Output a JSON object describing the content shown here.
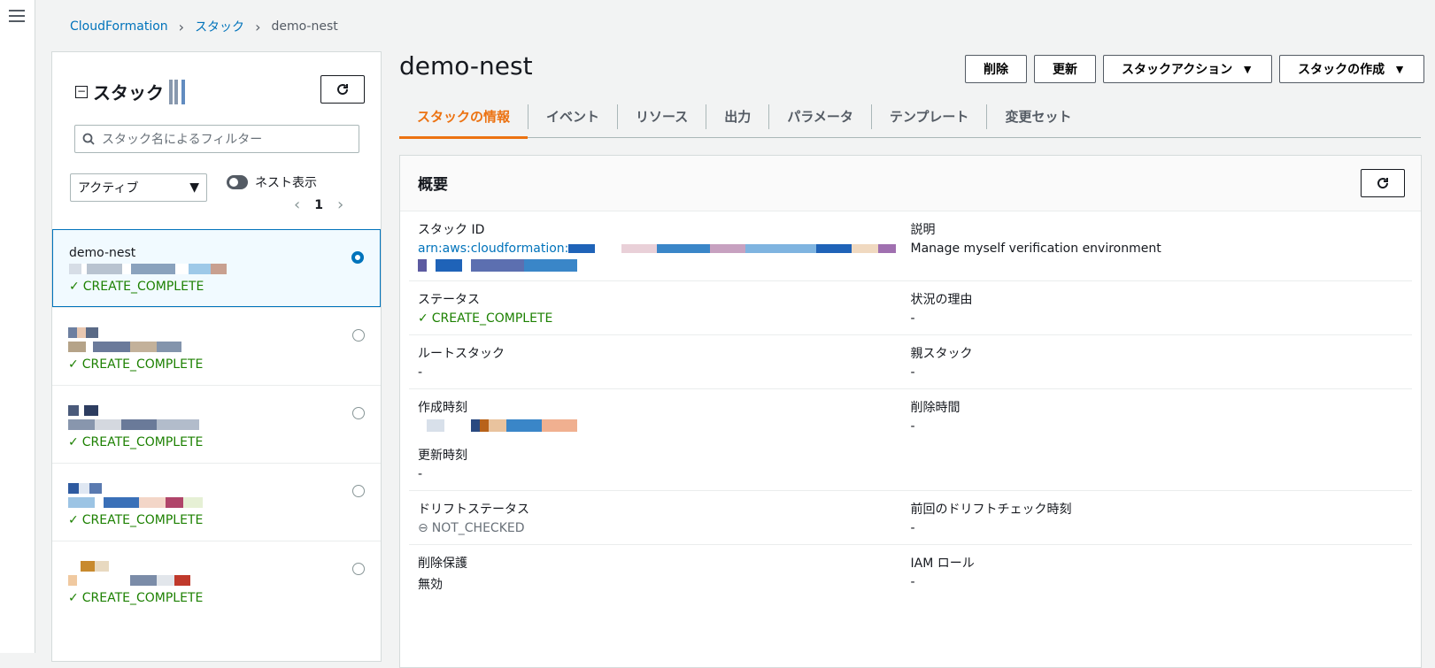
{
  "breadcrumb": {
    "root": "CloudFormation",
    "section": "スタック",
    "current": "demo-nest"
  },
  "sidebar": {
    "title": "スタック",
    "search_placeholder": "スタック名によるフィルター",
    "filter_select": "アクティブ",
    "nested_toggle_label": "ネスト表示",
    "page": "1",
    "stacks": [
      {
        "name": "demo-nest",
        "status": "CREATE_COMPLETE",
        "selected": true
      },
      {
        "name": "",
        "status": "CREATE_COMPLETE",
        "selected": false
      },
      {
        "name": "",
        "status": "CREATE_COMPLETE",
        "selected": false
      },
      {
        "name": "",
        "status": "CREATE_COMPLETE",
        "selected": false
      },
      {
        "name": "",
        "status": "CREATE_COMPLETE",
        "selected": false
      }
    ]
  },
  "header": {
    "title": "demo-nest",
    "delete": "削除",
    "update": "更新",
    "stack_actions": "スタックアクション",
    "create_stack": "スタックの作成"
  },
  "tabs": [
    "スタックの情報",
    "イベント",
    "リソース",
    "出力",
    "パラメータ",
    "テンプレート",
    "変更セット"
  ],
  "overview": {
    "title": "概要",
    "stack_id_label": "スタック ID",
    "stack_id_prefix": "arn:aws:cloudformation:",
    "description_label": "説明",
    "description": "Manage myself verification environment",
    "status_label": "ステータス",
    "status": "CREATE_COMPLETE",
    "status_reason_label": "状況の理由",
    "status_reason": "-",
    "root_stack_label": "ルートスタック",
    "root_stack": "-",
    "parent_stack_label": "親スタック",
    "parent_stack": "-",
    "created_label": "作成時刻",
    "deleted_label": "削除時間",
    "deleted": "-",
    "updated_label": "更新時刻",
    "updated": "-",
    "drift_status_label": "ドリフトステータス",
    "drift_status": "NOT_CHECKED",
    "last_drift_label": "前回のドリフトチェック時刻",
    "last_drift": "-",
    "termination_label": "削除保護",
    "termination": "無効",
    "iam_role_label": "IAM ロール",
    "iam_role": "-"
  },
  "colors": {
    "accent": "#ec7211",
    "link": "#0073bb",
    "success": "#1d8102"
  }
}
